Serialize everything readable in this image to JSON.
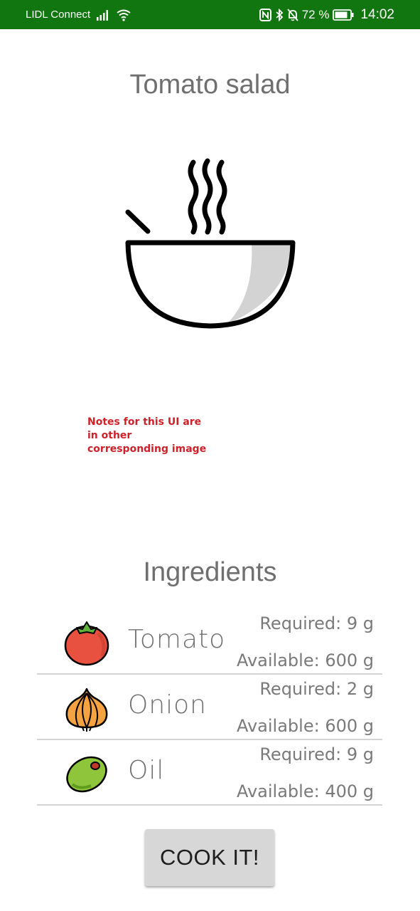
{
  "status_bar": {
    "carrier": "LIDL Connect",
    "battery": "72 %",
    "time": "14:02",
    "icons": [
      "signal-icon",
      "wifi-icon",
      "nfc-icon",
      "bluetooth-icon",
      "bell-off-icon",
      "battery-icon"
    ]
  },
  "recipe": {
    "title": "Tomato salad",
    "image_icon": "steaming-bowl-icon"
  },
  "note": "Notes for this UI are in other corresponding image",
  "ingredients": {
    "heading": "Ingredients",
    "items": [
      {
        "name": "Tomato",
        "icon": "tomato-icon",
        "required": "Required: 9 g",
        "available": "Available: 600 g"
      },
      {
        "name": "Onion",
        "icon": "onion-icon",
        "required": "Required: 2 g",
        "available": "Available: 600 g"
      },
      {
        "name": "Oil",
        "icon": "olive-icon",
        "required": "Required: 9 g",
        "available": "Available: 400 g"
      }
    ]
  },
  "actions": {
    "cook_label": "COOK IT!"
  },
  "colors": {
    "status_bar": "#11760f",
    "note_text": "#d0202a"
  }
}
